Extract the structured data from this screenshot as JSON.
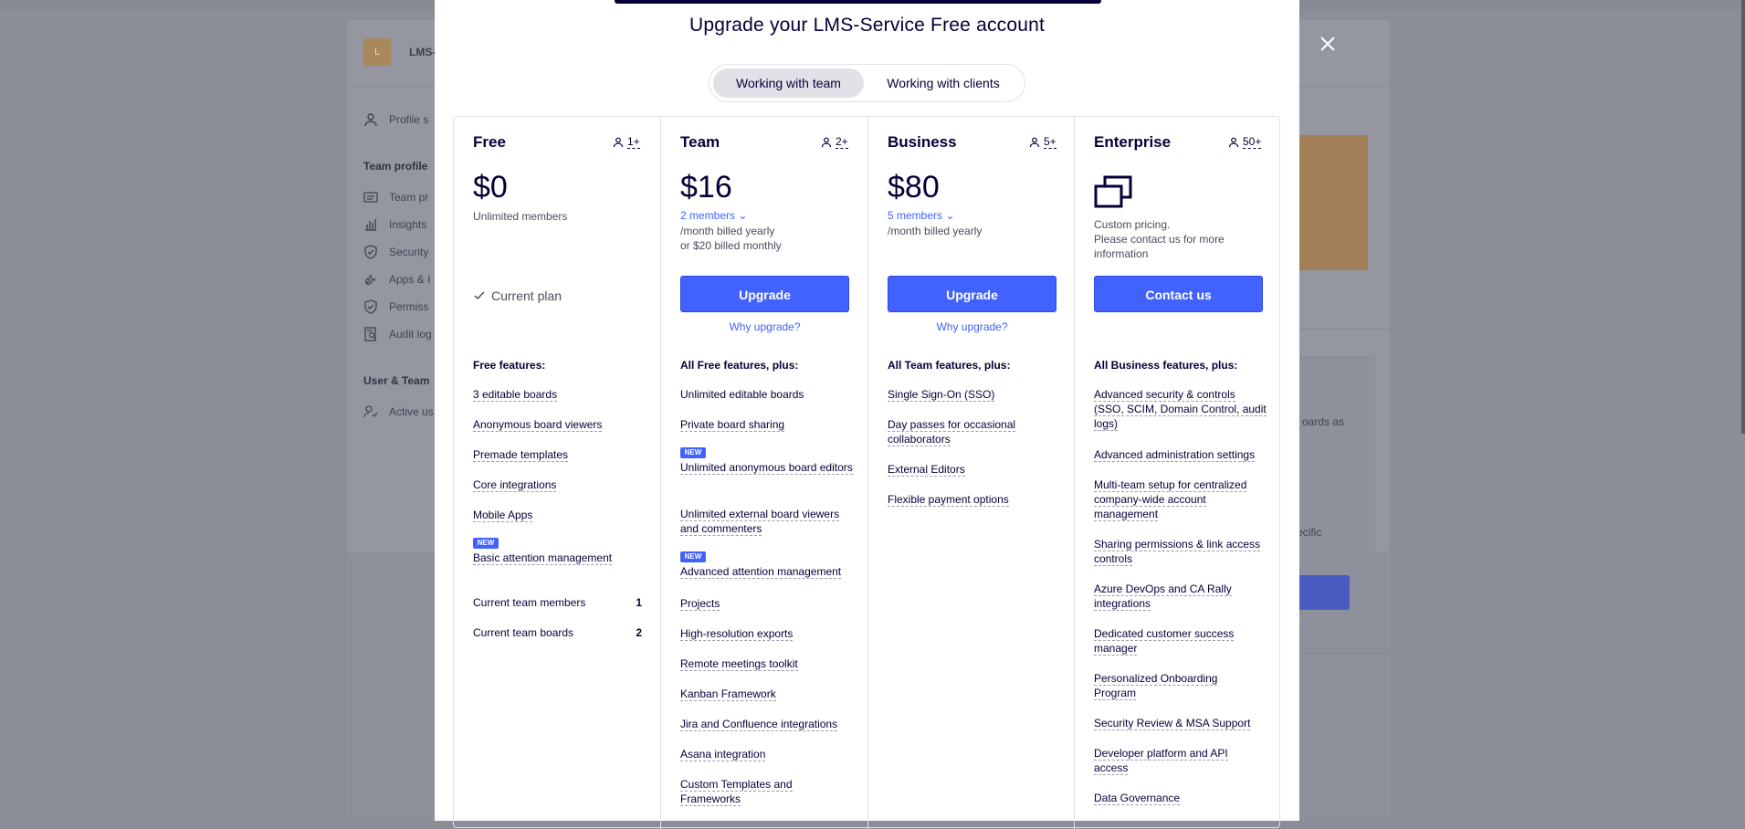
{
  "background": {
    "workspace_initial": "L",
    "workspace_name": "LMS-",
    "nav": [
      {
        "label": "Profile s",
        "icon": "user-icon"
      },
      {
        "label": "Team pr",
        "icon": "id-card-icon"
      },
      {
        "label": "Insights",
        "icon": "bar-chart-icon"
      },
      {
        "label": "Security",
        "icon": "shield-icon"
      },
      {
        "label": "Apps & I",
        "icon": "plug-icon"
      },
      {
        "label": "Permiss",
        "icon": "shield-check-icon"
      },
      {
        "label": "Audit log",
        "icon": "audit-icon"
      },
      {
        "label": "Active us",
        "icon": "user-check-icon"
      }
    ],
    "section_team": "Team profile",
    "section_user": "User & Team",
    "right_text_1": "oards as",
    "right_text_2": "ecific"
  },
  "modal": {
    "title": "Upgrade your LMS-Service Free account",
    "toggle": {
      "team": "Working with team",
      "clients": "Working with clients"
    },
    "plans": [
      {
        "name": "Free",
        "seats": "1+",
        "price": "$0",
        "subtitle": "Unlimited members",
        "current_plan": "Current plan",
        "features_heading": "Free features:",
        "features": [
          {
            "text": "3 editable boards",
            "new": false
          },
          {
            "text": "Anonymous board viewers",
            "new": false
          },
          {
            "text": "Premade templates",
            "new": false
          },
          {
            "text": "Core integrations",
            "new": false
          },
          {
            "text": "Mobile Apps",
            "new": false
          },
          {
            "text": "Basic attention management",
            "new": true
          }
        ],
        "stats": [
          {
            "label": "Current team members",
            "value": "1"
          },
          {
            "label": "Current team boards",
            "value": "2"
          }
        ]
      },
      {
        "name": "Team",
        "seats": "2+",
        "price": "$16",
        "members": "2 members",
        "billing_1": "/month billed yearly",
        "billing_2": "or $20 billed monthly",
        "button": "Upgrade",
        "why": "Why upgrade?",
        "features_heading": "All Free features, plus:",
        "features": [
          {
            "text": "Unlimited editable boards",
            "new": false,
            "underline": false
          },
          {
            "text": "Private board sharing",
            "new": false
          },
          {
            "text": "Unlimited anonymous board editors",
            "new": true
          },
          {
            "text": "Unlimited external board viewers and commenters",
            "new": false
          },
          {
            "text": "Advanced attention management",
            "new": true
          },
          {
            "text": "Projects",
            "new": false
          },
          {
            "text": "High-resolution exports",
            "new": false
          },
          {
            "text": "Remote meetings toolkit",
            "new": false
          },
          {
            "text": "Kanban Framework",
            "new": false
          },
          {
            "text": "Jira and Confluence integrations",
            "new": false
          },
          {
            "text": "Asana integration",
            "new": false
          },
          {
            "text": "Custom Templates and Frameworks",
            "new": false
          }
        ]
      },
      {
        "name": "Business",
        "seats": "5+",
        "price": "$80",
        "members": "5 members",
        "billing_1": "/month billed yearly",
        "button": "Upgrade",
        "why": "Why upgrade?",
        "features_heading": "All Team features, plus:",
        "features": [
          {
            "text": "Single Sign-On (SSO)",
            "new": false
          },
          {
            "text": "Day passes for occasional collaborators",
            "new": false
          },
          {
            "text": "External Editors",
            "new": false
          },
          {
            "text": "Flexible payment options",
            "new": false
          }
        ]
      },
      {
        "name": "Enterprise",
        "seats": "50+",
        "desc_1": "Custom pricing.",
        "desc_2": "Please contact us for more information",
        "button": "Contact us",
        "features_heading": "All Business features, plus:",
        "features": [
          {
            "text": "Advanced security & controls (SSO, SCIM, Domain Control, audit logs)",
            "new": false
          },
          {
            "text": "Advanced administration settings",
            "new": false
          },
          {
            "text": "Multi-team setup for centralized company-wide account management",
            "new": false
          },
          {
            "text": "Sharing permissions & link access controls",
            "new": false
          },
          {
            "text": "Azure DevOps and CA Rally integrations",
            "new": false
          },
          {
            "text": "Dedicated customer success manager",
            "new": false
          },
          {
            "text": "Personalized Onboarding Program",
            "new": false
          },
          {
            "text": "Security Review & MSA Support",
            "new": false
          },
          {
            "text": "Developer platform and API access",
            "new": false
          },
          {
            "text": "Data Governance",
            "new": false
          }
        ]
      }
    ],
    "new_badge": "NEW"
  },
  "colors": {
    "accent": "#4262ff",
    "ink": "#050038",
    "overlay": "#8b8e97"
  }
}
